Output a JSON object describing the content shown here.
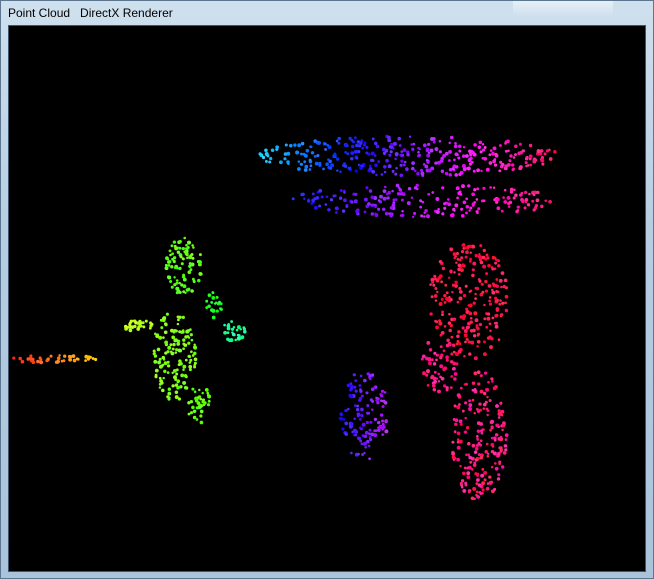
{
  "window": {
    "title": "Point Cloud   DirectX Renderer"
  },
  "viewport": {
    "background": "#000000",
    "render_style": "point cloud colored by depth (rainbow hue)",
    "objects": [
      {
        "name": "person-walking",
        "color": "green"
      },
      {
        "name": "thin-streak-left",
        "color": "red-yellow"
      },
      {
        "name": "table-top",
        "color": "cyan-blue-magenta-red"
      },
      {
        "name": "table-legs",
        "color": "red-magenta"
      },
      {
        "name": "small-object",
        "color": "blue-violet"
      }
    ]
  }
}
